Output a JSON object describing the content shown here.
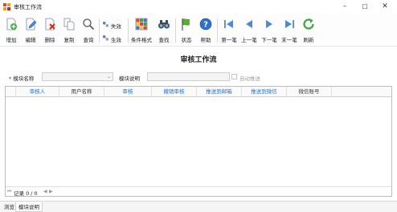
{
  "window": {
    "title": "审核工作流",
    "controls": [
      "–",
      "☐",
      "✕"
    ]
  },
  "toolbar": {
    "buttons": [
      {
        "label": "增加",
        "icon": "add-document-icon"
      },
      {
        "label": "编辑",
        "icon": "edit-document-icon"
      },
      {
        "label": "删除",
        "icon": "delete-document-icon"
      },
      {
        "label": "复制",
        "icon": "copy-document-icon"
      },
      {
        "label": "查询",
        "icon": "search-icon"
      },
      {
        "label": "失效",
        "icon": "disable-icon"
      },
      {
        "label": "生效",
        "icon": "enable-icon"
      },
      {
        "label": "条件格式",
        "icon": "conditional-format-icon"
      },
      {
        "label": "查找",
        "icon": "binoculars-icon"
      },
      {
        "label": "状态",
        "icon": "flag-icon"
      },
      {
        "label": "帮助",
        "icon": "help-icon"
      },
      {
        "label": "第一笔",
        "icon": "first-record-icon"
      },
      {
        "label": "上一笔",
        "icon": "previous-record-icon"
      },
      {
        "label": "下一笔",
        "icon": "next-record-icon"
      },
      {
        "label": "末一笔",
        "icon": "last-record-icon"
      },
      {
        "label": "刷新",
        "icon": "refresh-icon"
      }
    ]
  },
  "main": {
    "heading": "审核工作流"
  },
  "form": {
    "required_mark": "*",
    "module_name_label": "模块名称",
    "module_name_value": "",
    "module_desc_label": "模块说明",
    "module_desc_value": "",
    "auto_push_label": "自动推送",
    "auto_push_checked": false
  },
  "grid": {
    "columns": [
      {
        "label": "审核人",
        "color": "#1e6fd9"
      },
      {
        "label": "用户名称",
        "color": "#333333"
      },
      {
        "label": "审核",
        "color": "#1e6fd9"
      },
      {
        "label": "撤销审核",
        "color": "#1e6fd9"
      },
      {
        "label": "推送到邮箱",
        "color": "#1e6fd9"
      },
      {
        "label": "推送到微信",
        "color": "#1e6fd9"
      },
      {
        "label": "微信账号",
        "color": "#333333"
      }
    ],
    "rows": [],
    "footer": {
      "first": "⏮",
      "prev": "◀",
      "record_text": "记录 0 / 0",
      "next": "▶",
      "last": "⏭"
    }
  },
  "tabs": [
    {
      "label": "浏览",
      "active": false
    },
    {
      "label": "模块说明",
      "active": true
    }
  ]
}
